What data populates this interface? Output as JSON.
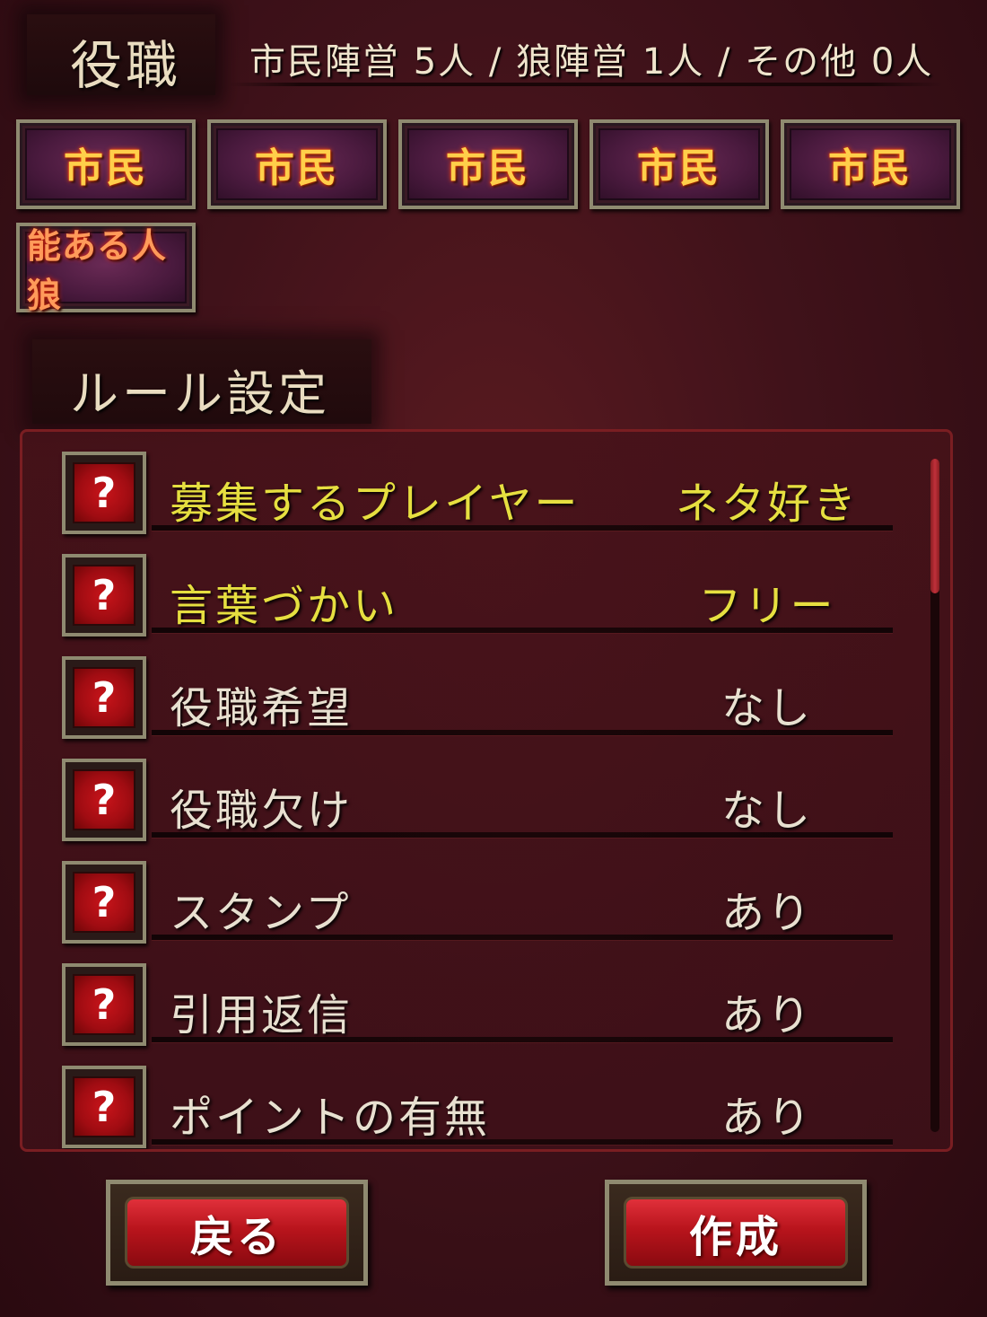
{
  "header": {
    "title": "役職",
    "summary": "市民陣営 5人 / 狼陣営 1人 / その他 0人"
  },
  "roles": [
    {
      "label": "市民",
      "type": "citizen"
    },
    {
      "label": "市民",
      "type": "citizen"
    },
    {
      "label": "市民",
      "type": "citizen"
    },
    {
      "label": "市民",
      "type": "citizen"
    },
    {
      "label": "市民",
      "type": "citizen"
    },
    {
      "label": "能ある人狼",
      "type": "wolf"
    }
  ],
  "rules": {
    "title": "ルール設定",
    "help_glyph": "?",
    "items": [
      {
        "label": "募集するプレイヤー",
        "value": "ネタ好き",
        "highlight": true
      },
      {
        "label": "言葉づかい",
        "value": "フリー",
        "highlight": true
      },
      {
        "label": "役職希望",
        "value": "なし",
        "highlight": false
      },
      {
        "label": "役職欠け",
        "value": "なし",
        "highlight": false
      },
      {
        "label": "スタンプ",
        "value": "あり",
        "highlight": false
      },
      {
        "label": "引用返信",
        "value": "あり",
        "highlight": false
      },
      {
        "label": "ポイントの有無",
        "value": "あり",
        "highlight": false
      }
    ]
  },
  "actions": {
    "back_label": "戻る",
    "create_label": "作成"
  },
  "colors": {
    "highlight_text": "#e6df40",
    "normal_text": "#e8e0d0",
    "role_text": "#ffcf4a"
  }
}
